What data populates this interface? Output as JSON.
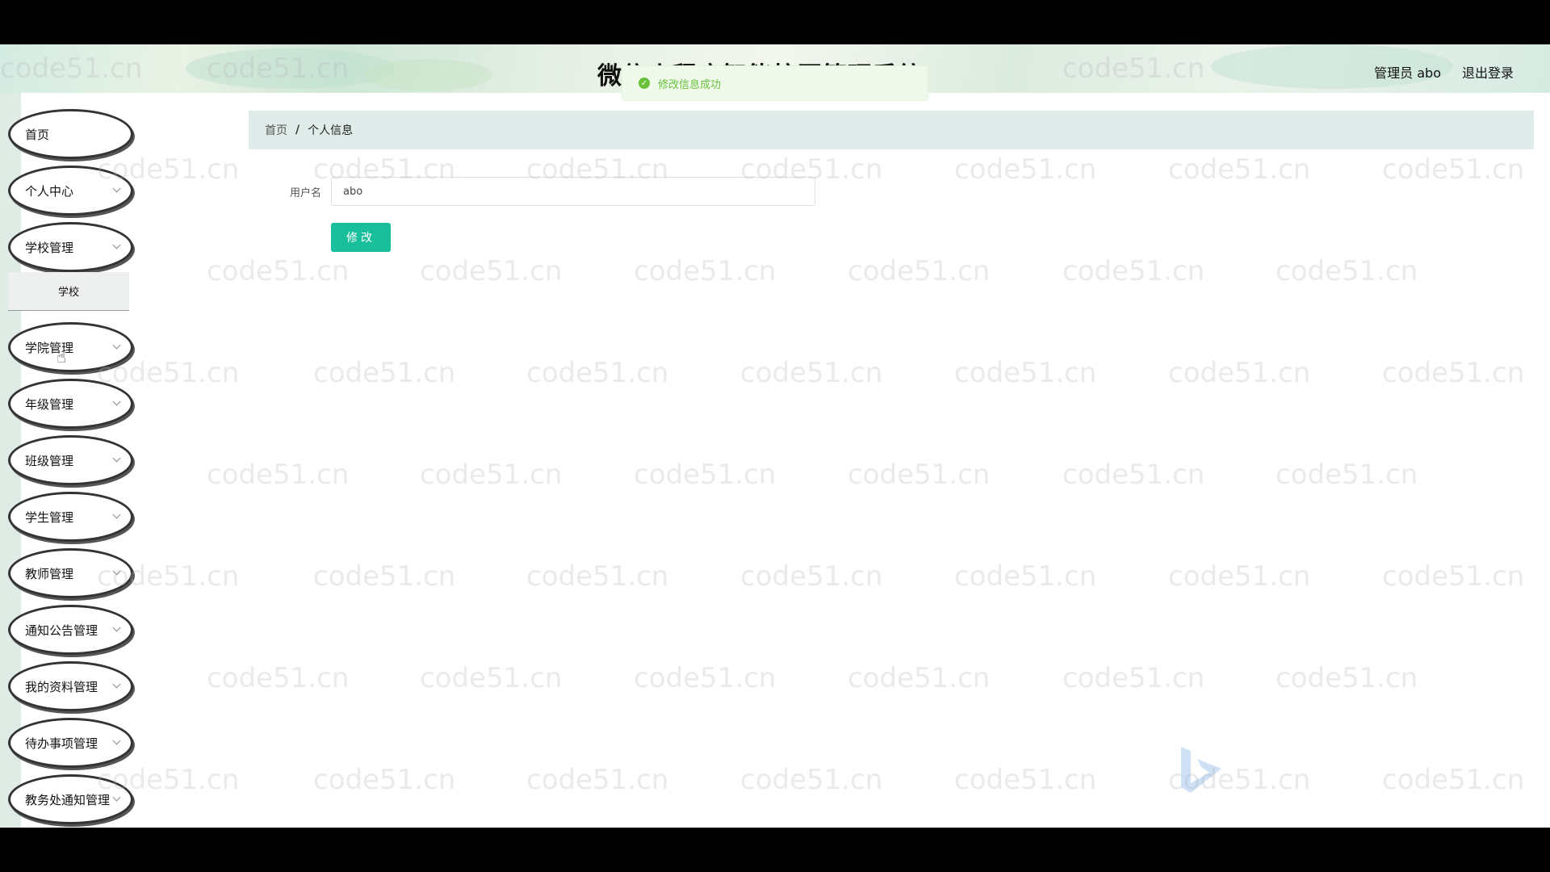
{
  "header": {
    "title": "微信小程序智能校园管理系统",
    "user": "管理员 abo",
    "logout": "退出登录"
  },
  "toast": {
    "message": "修改信息成功"
  },
  "sidebar": {
    "items": [
      {
        "label": "首页",
        "has_arrow": false
      },
      {
        "label": "个人中心",
        "has_arrow": true
      },
      {
        "label": "学校管理",
        "has_arrow": true
      },
      {
        "label": "学院管理",
        "has_arrow": true
      },
      {
        "label": "年级管理",
        "has_arrow": true
      },
      {
        "label": "班级管理",
        "has_arrow": true
      },
      {
        "label": "学生管理",
        "has_arrow": true
      },
      {
        "label": "教师管理",
        "has_arrow": true
      },
      {
        "label": "通知公告管理",
        "has_arrow": true
      },
      {
        "label": "我的资料管理",
        "has_arrow": true
      },
      {
        "label": "待办事项管理",
        "has_arrow": true
      },
      {
        "label": "教务处通知管理",
        "has_arrow": true
      }
    ],
    "submenu": {
      "label": "学校"
    }
  },
  "breadcrumb": {
    "home": "首页",
    "separator": "/",
    "current": "个人信息"
  },
  "form": {
    "username_label": "用户名",
    "username_value": "abo",
    "submit_label": "修改"
  },
  "watermark": {
    "text": "code51.cn"
  },
  "colors": {
    "accent": "#19be9b",
    "success": "#67c23a",
    "breadcrumb_bg": "#dfecea"
  }
}
